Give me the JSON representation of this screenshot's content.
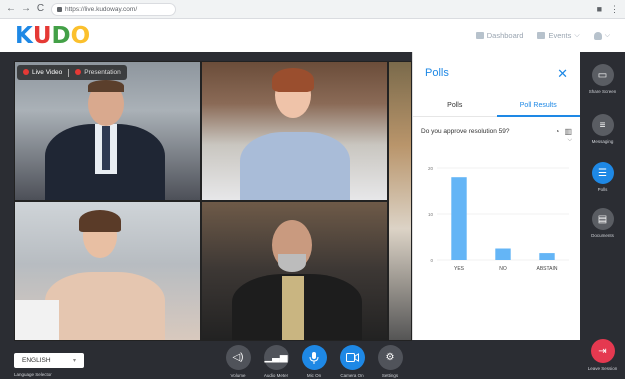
{
  "browser": {
    "url": "https://live.kudoway.com/",
    "back": "←",
    "forward": "→",
    "reload": "C"
  },
  "header": {
    "logo": [
      "K",
      "U",
      "D",
      "O"
    ],
    "dashboard": "Dashboard",
    "events": "Events"
  },
  "stage": {
    "tabs": {
      "live": "Live Video",
      "presentation": "Presentation"
    }
  },
  "polls": {
    "title": "Polls",
    "close": "✕",
    "tabs": [
      "Polls",
      "Poll Results"
    ],
    "question": "Do you approve resolution 59?"
  },
  "chart_data": {
    "type": "bar",
    "categories": [
      "YES",
      "NO",
      "ABSTAIN"
    ],
    "values": [
      18,
      2.5,
      1.5
    ],
    "ylim": [
      0,
      20
    ],
    "yticks": [
      "0",
      "10",
      "20"
    ],
    "bar_color": "#64b5f6"
  },
  "rail": {
    "items": [
      {
        "label": "Share Screen",
        "icon": "share-screen-icon"
      },
      {
        "label": "Messaging",
        "icon": "message-icon"
      },
      {
        "label": "Polls",
        "icon": "poll-icon"
      },
      {
        "label": "Documents",
        "icon": "document-icon"
      },
      {
        "label": "Leave Session",
        "icon": "exit-icon"
      }
    ]
  },
  "bottom": {
    "language": "ENGLISH",
    "language_caption": "Language Selector",
    "controls": [
      {
        "label": "Volume",
        "icon": "volume-icon"
      },
      {
        "label": "Audio Meter",
        "icon": "audio-meter-icon"
      },
      {
        "label": "Mic On",
        "icon": "microphone-icon"
      },
      {
        "label": "Camera On",
        "icon": "camera-icon"
      },
      {
        "label": "Settings",
        "icon": "settings-icon"
      }
    ]
  },
  "colors": {
    "accent": "#1e88e5",
    "leave": "#e53950",
    "stage_bg": "#2b2d33"
  }
}
